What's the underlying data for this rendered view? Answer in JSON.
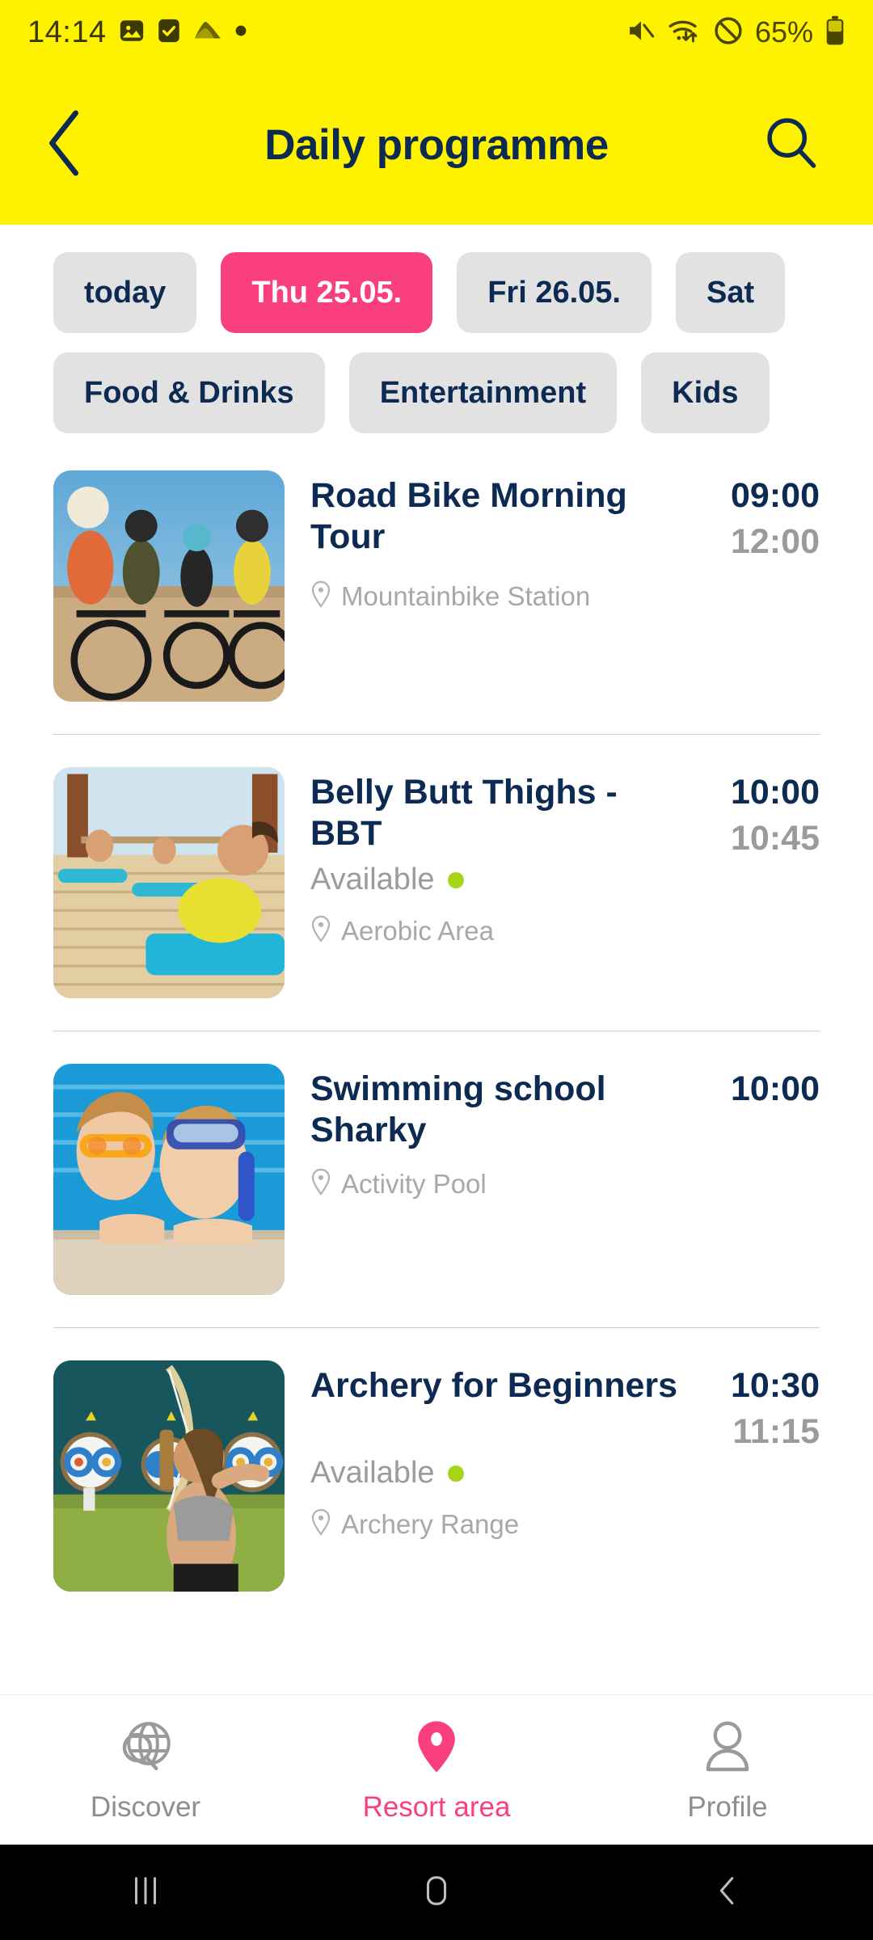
{
  "status_bar": {
    "time": "14:14",
    "battery_percent": "65%",
    "left_icons": [
      "gallery-icon",
      "checkbox-icon",
      "cloud-icon",
      "dot-icon"
    ],
    "right_icons": [
      "mute-icon",
      "wifi-transfer-icon",
      "do-not-disturb-icon",
      "battery-icon"
    ]
  },
  "app_bar": {
    "title": "Daily programme",
    "back_icon": "back-chevron-icon",
    "search_icon": "search-icon",
    "background_color": "#FFF200",
    "title_color": "#0D2B52"
  },
  "filters": {
    "dates": [
      {
        "label": "today",
        "selected": false
      },
      {
        "label": "Thu 25.05.",
        "selected": true
      },
      {
        "label": "Fri 26.05.",
        "selected": false
      },
      {
        "label": "Sat",
        "selected": false
      }
    ],
    "categories": [
      {
        "label": "Food & Drinks",
        "selected": false
      },
      {
        "label": "Entertainment",
        "selected": false
      },
      {
        "label": "Kids",
        "selected": false
      }
    ],
    "selected_color": "#FA3F7D",
    "chip_color": "#E2E2E2"
  },
  "events": [
    {
      "title": "Road Bike Morning Tour",
      "availability": null,
      "location": "Mountainbike Station",
      "start_time": "09:00",
      "end_time": "12:00",
      "image": "cyclists-photo"
    },
    {
      "title": "Belly Butt Thighs - BBT",
      "availability": "Available",
      "location": "Aerobic Area",
      "start_time": "10:00",
      "end_time": "10:45",
      "image": "fitness-class-photo"
    },
    {
      "title": "Swimming school Sharky",
      "availability": null,
      "location": "Activity Pool",
      "start_time": "10:00",
      "end_time": "",
      "image": "kids-pool-photo"
    },
    {
      "title": "Archery for Beginners",
      "availability": "Available",
      "location": "Archery Range",
      "start_time": "10:30",
      "end_time": "11:15",
      "image": "archery-photo"
    }
  ],
  "bottom_nav": {
    "items": [
      {
        "label": "Discover",
        "icon": "globe-search-icon",
        "active": false
      },
      {
        "label": "Resort area",
        "icon": "map-pin-icon",
        "active": true
      },
      {
        "label": "Profile",
        "icon": "person-icon",
        "active": false
      }
    ],
    "active_color": "#FA3F7D",
    "inactive_color": "#8E8E8E"
  },
  "android_nav": {
    "recents_icon": "recents-icon",
    "home_icon": "home-icon",
    "back_icon": "back-icon"
  }
}
